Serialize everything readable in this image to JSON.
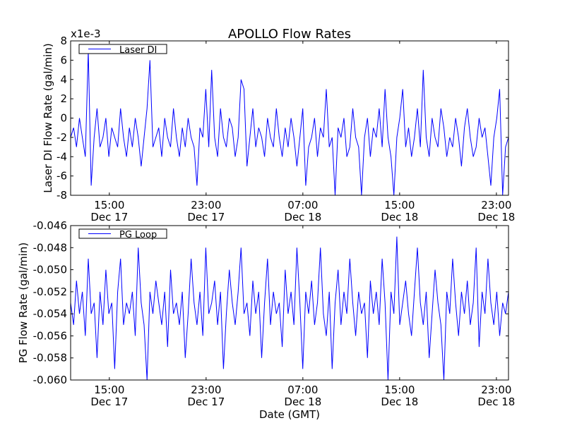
{
  "chart_data": [
    {
      "type": "line",
      "title": "APOLLO Flow Rates",
      "ylabel": "Laser DI Flow Rate (gal/min)",
      "xlabel": "",
      "y_multiplier_label": "x1e-3",
      "legend": {
        "entries": [
          "Laser DI"
        ],
        "placement": "top-left"
      },
      "color": "#0000ff",
      "xlim_hours_since_dec17_0000": [
        11.8,
        48.0
      ],
      "xticks": [
        {
          "hour": 15,
          "time": "15:00",
          "date": "Dec 17"
        },
        {
          "hour": 23,
          "time": "23:00",
          "date": "Dec 17"
        },
        {
          "hour": 31,
          "time": "07:00",
          "date": "Dec 18"
        },
        {
          "hour": 39,
          "time": "15:00",
          "date": "Dec 18"
        },
        {
          "hour": 47,
          "time": "23:00",
          "date": "Dec 18"
        }
      ],
      "ylim": [
        -8,
        8
      ],
      "yticks": [
        {
          "v": 8,
          "label": "8"
        },
        {
          "v": 6,
          "label": "6"
        },
        {
          "v": 4,
          "label": "4"
        },
        {
          "v": 2,
          "label": "2"
        },
        {
          "v": 0,
          "label": "0"
        },
        {
          "v": -2,
          "label": "-2"
        },
        {
          "v": -4,
          "label": "-4"
        },
        {
          "v": -6,
          "label": "-6"
        },
        {
          "v": -8,
          "label": "-8"
        }
      ],
      "series": [
        {
          "name": "Laser DI",
          "values": [
            -2,
            -1,
            -3,
            0,
            -2,
            -4,
            7,
            -7,
            -2,
            1,
            -3,
            -2,
            0,
            -4,
            -1,
            -2,
            -3,
            1,
            -2,
            -4,
            -1,
            -3,
            0,
            -2,
            -5,
            -2,
            1,
            6,
            -3,
            -2,
            -1,
            -4,
            0,
            -2,
            -3,
            1,
            -2,
            -4,
            -1,
            -3,
            0,
            -2,
            -3,
            -7,
            -1,
            -2,
            3,
            -3,
            5,
            -2,
            -4,
            1,
            -2,
            -3,
            0,
            -1,
            -4,
            -2,
            4,
            3,
            -5,
            -2,
            1,
            -3,
            -1,
            -2,
            -4,
            0,
            -2,
            -3,
            1,
            -2,
            -4,
            -1,
            -3,
            0,
            -2,
            -5,
            -2,
            1,
            -7,
            -3,
            -2,
            0,
            -4,
            -1,
            -2,
            3,
            -3,
            -2,
            -8,
            -1,
            -2,
            0,
            -4,
            -3,
            1,
            -2,
            -3,
            -8,
            -2,
            0,
            -4,
            -1,
            -2,
            1,
            -3,
            3,
            -2,
            -4,
            -8,
            -2,
            0,
            3,
            -3,
            -1,
            -4,
            -2,
            1,
            -3,
            5,
            -2,
            -4,
            0,
            -2,
            -3,
            1,
            -1,
            -4,
            -2,
            -3,
            0,
            -2,
            -5,
            -1,
            1,
            -2,
            -4,
            -3,
            0,
            -2,
            -1,
            -4,
            -7,
            -2,
            0,
            3,
            -8,
            -3,
            -2
          ]
        }
      ]
    },
    {
      "type": "line",
      "title": "",
      "ylabel": "PG Flow Rate (gal/min)",
      "xlabel": "Date (GMT)",
      "legend": {
        "entries": [
          "PG Loop"
        ],
        "placement": "top-left"
      },
      "color": "#0000ff",
      "xlim_hours_since_dec17_0000": [
        11.8,
        48.0
      ],
      "xticks": [
        {
          "hour": 15,
          "time": "15:00",
          "date": "Dec 17"
        },
        {
          "hour": 23,
          "time": "23:00",
          "date": "Dec 17"
        },
        {
          "hour": 31,
          "time": "07:00",
          "date": "Dec 18"
        },
        {
          "hour": 39,
          "time": "15:00",
          "date": "Dec 18"
        },
        {
          "hour": 47,
          "time": "23:00",
          "date": "Dec 18"
        }
      ],
      "ylim": [
        -0.06,
        -0.046
      ],
      "yticks": [
        {
          "v": -0.046,
          "label": "-0.046"
        },
        {
          "v": -0.048,
          "label": "-0.048"
        },
        {
          "v": -0.05,
          "label": "-0.050"
        },
        {
          "v": -0.052,
          "label": "-0.052"
        },
        {
          "v": -0.054,
          "label": "-0.054"
        },
        {
          "v": -0.056,
          "label": "-0.056"
        },
        {
          "v": -0.058,
          "label": "-0.058"
        },
        {
          "v": -0.06,
          "label": "-0.060"
        }
      ],
      "series": [
        {
          "name": "PG Loop",
          "values": [
            -0.053,
            -0.055,
            -0.051,
            -0.054,
            -0.052,
            -0.056,
            -0.049,
            -0.054,
            -0.053,
            -0.058,
            -0.052,
            -0.055,
            -0.05,
            -0.054,
            -0.053,
            -0.059,
            -0.052,
            -0.049,
            -0.055,
            -0.053,
            -0.054,
            -0.052,
            -0.056,
            -0.048,
            -0.053,
            -0.055,
            -0.06,
            -0.052,
            -0.054,
            -0.051,
            -0.053,
            -0.055,
            -0.052,
            -0.057,
            -0.05,
            -0.054,
            -0.053,
            -0.055,
            -0.052,
            -0.058,
            -0.054,
            -0.049,
            -0.053,
            -0.055,
            -0.052,
            -0.056,
            -0.048,
            -0.054,
            -0.053,
            -0.051,
            -0.055,
            -0.052,
            -0.059,
            -0.054,
            -0.05,
            -0.053,
            -0.055,
            -0.052,
            -0.048,
            -0.054,
            -0.053,
            -0.056,
            -0.051,
            -0.054,
            -0.052,
            -0.058,
            -0.053,
            -0.049,
            -0.055,
            -0.052,
            -0.054,
            -0.053,
            -0.057,
            -0.05,
            -0.054,
            -0.052,
            -0.055,
            -0.048,
            -0.053,
            -0.059,
            -0.052,
            -0.054,
            -0.051,
            -0.055,
            -0.053,
            -0.048,
            -0.054,
            -0.056,
            -0.052,
            -0.059,
            -0.053,
            -0.05,
            -0.055,
            -0.052,
            -0.054,
            -0.049,
            -0.053,
            -0.056,
            -0.052,
            -0.054,
            -0.053,
            -0.058,
            -0.051,
            -0.054,
            -0.052,
            -0.055,
            -0.049,
            -0.053,
            -0.06,
            -0.052,
            -0.054,
            -0.047,
            -0.055,
            -0.053,
            -0.051,
            -0.054,
            -0.056,
            -0.052,
            -0.048,
            -0.053,
            -0.055,
            -0.052,
            -0.058,
            -0.054,
            -0.05,
            -0.053,
            -0.055,
            -0.06,
            -0.052,
            -0.054,
            -0.049,
            -0.053,
            -0.056,
            -0.052,
            -0.054,
            -0.051,
            -0.055,
            -0.053,
            -0.048,
            -0.057,
            -0.052,
            -0.054,
            -0.049,
            -0.053,
            -0.055,
            -0.052,
            -0.056,
            -0.053,
            -0.054,
            -0.052
          ]
        }
      ]
    }
  ]
}
